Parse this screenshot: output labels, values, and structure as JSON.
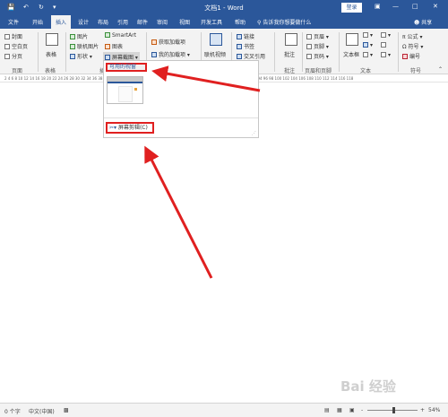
{
  "titlebar": {
    "title": "文档1 - Word",
    "login_label": "登录",
    "quick_access": [
      "save-icon",
      "undo-icon",
      "redo-icon",
      "customize-icon"
    ],
    "window_controls": [
      "ribbon-display-icon",
      "minimize-icon",
      "maximize-icon",
      "close-icon"
    ]
  },
  "tabs": [
    "文件",
    "开始",
    "插入",
    "设计",
    "布局",
    "引用",
    "邮件",
    "审阅",
    "视图",
    "开发工具",
    "帮助"
  ],
  "active_tab": "插入",
  "tellme": "告诉我你想要做什么",
  "share_label": "共享",
  "ribbon": {
    "pages": {
      "cover": "封面",
      "blank": "空白页",
      "break": "分页",
      "group": "页面"
    },
    "tables": {
      "table": "表格",
      "group": "表格"
    },
    "illustrations": {
      "pictures": "图片",
      "online_pictures": "联机图片",
      "shapes": "形状",
      "smartart": "SmartArt",
      "chart": "图表",
      "screenshot": "屏幕截图",
      "group_partial": "插"
    },
    "addins": {
      "get": "获取加载项",
      "my": "我的加载项"
    },
    "media": {
      "online_video": "联机视频"
    },
    "links": {
      "link": "链接",
      "bookmark": "书签",
      "crossref": "交叉引用"
    },
    "comments": {
      "comment": "批注",
      "group": "批注"
    },
    "header_footer": {
      "header": "页眉",
      "footer": "页脚",
      "page_number": "页码",
      "group": "页眉和页脚"
    },
    "text": {
      "textbox": "文本框",
      "group": "文本"
    },
    "symbols": {
      "equation": "公式",
      "symbol": "符号",
      "number": "编号",
      "group": "符号"
    }
  },
  "ruler_text": "2  4  6  8  10  12  14  16  18  20  22  24  26  28  30  32  34  36  38  40  42  44  46  48  50  52  54  56  58  60  62  64  66  68  70  72  74  76  78  80  82  84  86  88  90  92  94  96  98  100 102 104 106 108 110 112 114 116 118",
  "dropdown": {
    "header": "可用的视窗",
    "clipping_label": "屏幕剪辑(C)"
  },
  "statusbar": {
    "words": "0 个字",
    "language": "中文(中国)",
    "zoom": "54%",
    "zoom_out": "-",
    "zoom_in": "+"
  },
  "watermark": "Bai 经验",
  "colors": {
    "word_blue": "#2b579a",
    "annotation_red": "#e02020"
  }
}
